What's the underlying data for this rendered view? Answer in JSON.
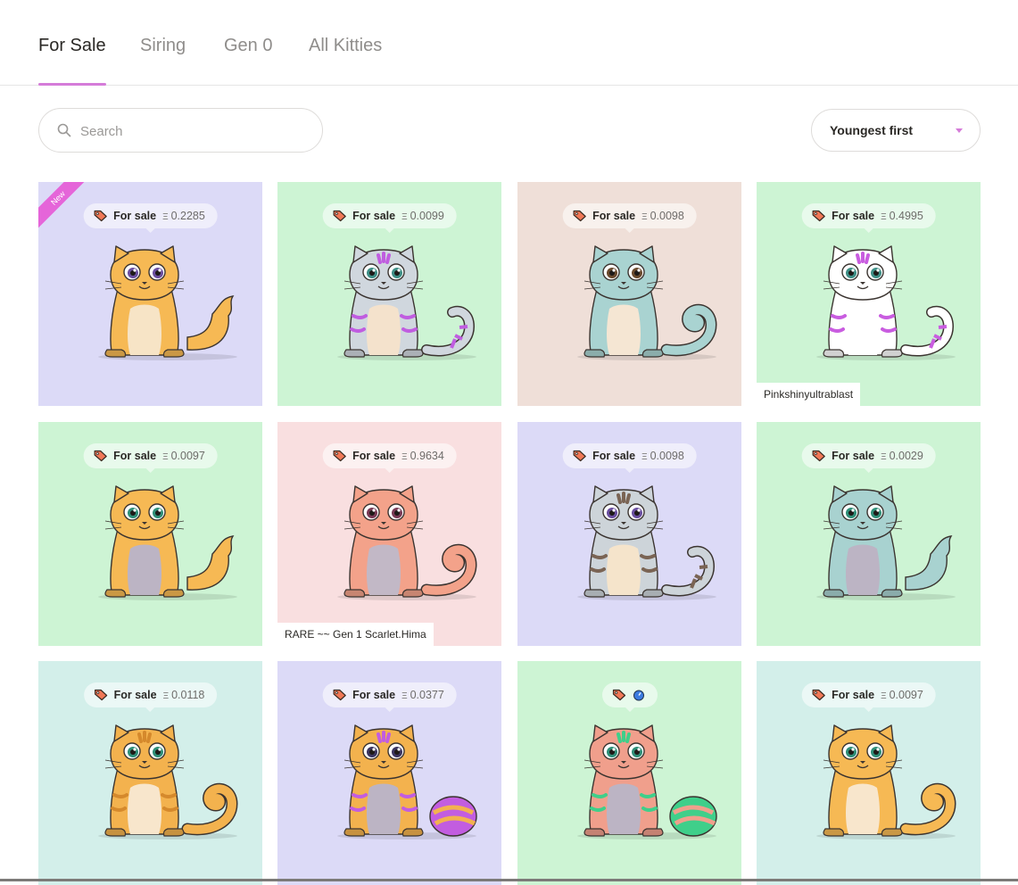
{
  "tabs": [
    {
      "label": "For Sale",
      "active": true
    },
    {
      "label": "Siring",
      "active": false
    },
    {
      "label": "Gen 0",
      "active": false
    },
    {
      "label": "All Kitties",
      "active": false
    }
  ],
  "search": {
    "placeholder": "Search",
    "value": ""
  },
  "sort": {
    "selected": "Youngest first"
  },
  "colors": {
    "accent": "#d57cd9",
    "ribbon": "#e565d9",
    "tag": "#f07857"
  },
  "new_badge": "New",
  "price_label": "For sale",
  "currency_symbol": "Ξ",
  "kitties": [
    {
      "price": "0.2285",
      "bg": "#dcdaf7",
      "body": "#f6b954",
      "belly": "#f7e4c6",
      "tail": "fluffy",
      "eyes": "#6b4fa0",
      "is_new": true
    },
    {
      "price": "0.0099",
      "bg": "#cdf4d4",
      "body": "#d0d7de",
      "belly": "#f4e2cc",
      "tail": "curly",
      "eyes": "#3e8f86",
      "stripes": "#c05de0"
    },
    {
      "price": "0.0098",
      "bg": "#efdfd8",
      "body": "#a9d3d1",
      "belly": "#f5e6d3",
      "tail": "curl",
      "eyes": "#6a4a2e"
    },
    {
      "price": "0.4995",
      "bg": "#cdf4d4",
      "body": "#ffffff",
      "belly": "#ffffff",
      "tail": "curly",
      "eyes": "#3e8f86",
      "stripes": "#c95de0",
      "name": "Pinkshinyultrablast"
    },
    {
      "price": "0.0097",
      "bg": "#cdf4d4",
      "body": "#f6b954",
      "belly": "#bcb4c4",
      "tail": "fluffy",
      "eyes": "#2f8f78"
    },
    {
      "price": "0.9634",
      "bg": "#f9dfe0",
      "body": "#f3a28a",
      "belly": "#c2b8c6",
      "tail": "curl",
      "eyes": "#7a3a55",
      "name": "RARE ~~ Gen 1 Scarlet.Hima"
    },
    {
      "price": "0.0098",
      "bg": "#dcdaf7",
      "body": "#cdd4d9",
      "belly": "#f5e4cb",
      "tail": "curly",
      "eyes": "#6a4fa0",
      "stripes": "#7a6454"
    },
    {
      "price": "0.0029",
      "bg": "#cdf4d4",
      "body": "#a8d2d0",
      "belly": "#bcb4c4",
      "tail": "fluffy",
      "eyes": "#2f8f78"
    },
    {
      "price": "0.0118",
      "bg": "#d3efea",
      "body": "#f3b24e",
      "belly": "#f8e6cc",
      "tail": "curl",
      "eyes": "#2f8f78",
      "stripes": "#d5892c"
    },
    {
      "price": "0.0377",
      "bg": "#dcdaf7",
      "body": "#f3b24e",
      "belly": "#bcb4c4",
      "tail": "ball",
      "eyes": "#3b3560",
      "stripes": "#c25de0"
    },
    {
      "price": "",
      "bg": "#cdf4d4",
      "body": "#f09f8c",
      "belly": "#bcb4c4",
      "tail": "ball",
      "eyes": "#2f8f78",
      "stripes": "#3fcf8a",
      "siring": true
    },
    {
      "price": "0.0097",
      "bg": "#d3efea",
      "body": "#f6b954",
      "belly": "#f8e6cc",
      "tail": "curl",
      "eyes": "#2f8f78"
    }
  ]
}
